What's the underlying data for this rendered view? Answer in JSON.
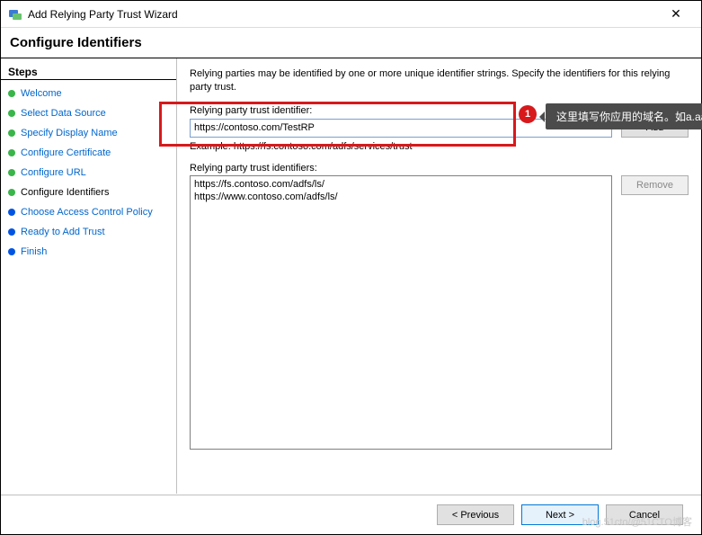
{
  "titlebar": {
    "title": "Add Relying Party Trust Wizard",
    "close": "✕"
  },
  "header": {
    "title": "Configure Identifiers"
  },
  "sidebar": {
    "title": "Steps",
    "items": [
      {
        "label": "Welcome",
        "state": "done"
      },
      {
        "label": "Select Data Source",
        "state": "done"
      },
      {
        "label": "Specify Display Name",
        "state": "done"
      },
      {
        "label": "Configure Certificate",
        "state": "done"
      },
      {
        "label": "Configure URL",
        "state": "done"
      },
      {
        "label": "Configure Identifiers",
        "state": "done",
        "current": true
      },
      {
        "label": "Choose Access Control Policy",
        "state": "current"
      },
      {
        "label": "Ready to Add Trust",
        "state": "current"
      },
      {
        "label": "Finish",
        "state": "current"
      }
    ]
  },
  "content": {
    "instruction": "Relying parties may be identified by one or more unique identifier strings. Specify the identifiers for this relying party trust.",
    "identifier_label": "Relying party trust identifier:",
    "identifier_value": "https://contoso.com/TestRP",
    "add_label": "Add",
    "example": "Example: https://fs.contoso.com/adfs/services/trust",
    "list_label": "Relying party trust identifiers:",
    "list_items": [
      "https://fs.contoso.com/adfs/ls/",
      "https://www.contoso.com/adfs/ls/"
    ],
    "remove_label": "Remove"
  },
  "footer": {
    "previous": "< Previous",
    "next": "Next >",
    "cancel": "Cancel"
  },
  "annotation": {
    "badge": "1",
    "tip": "这里填写你应用的域名。如a.aaa.com"
  },
  "watermark": "blog.51cto/@51CTO博客"
}
